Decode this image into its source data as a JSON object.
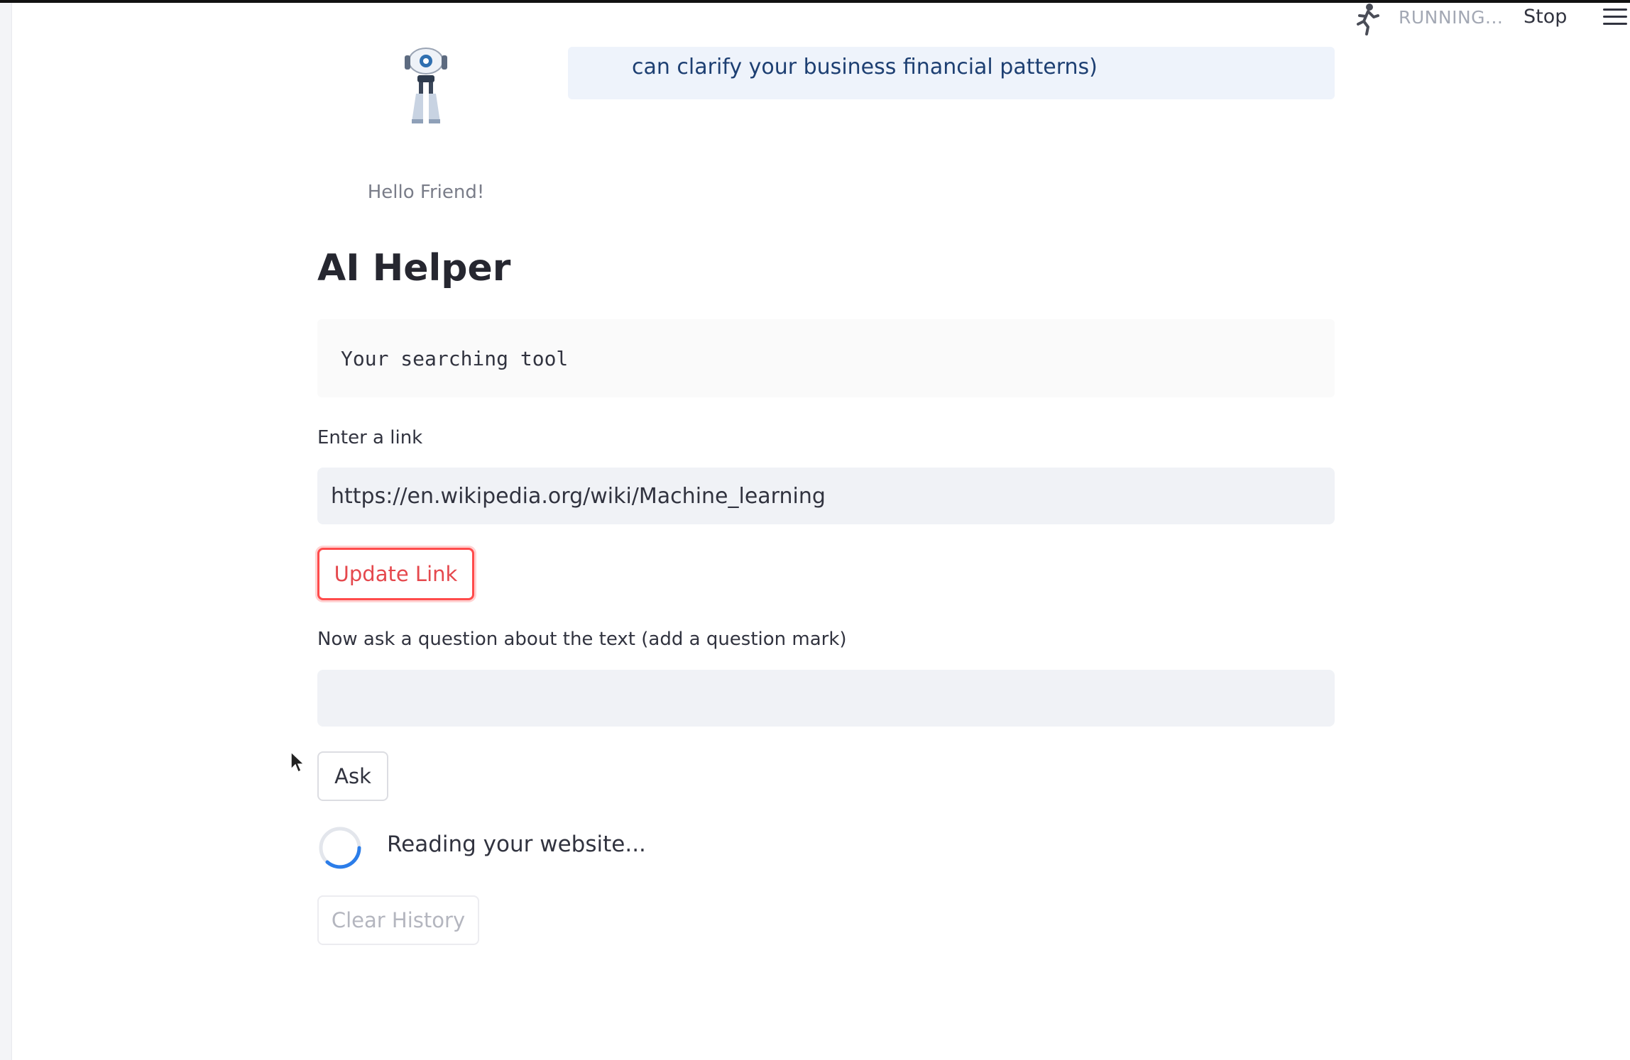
{
  "toolbar": {
    "status_text": "RUNNING...",
    "stop_label": "Stop",
    "status_icon": "running-man-icon",
    "menu_icon": "hamburger-menu-icon"
  },
  "sidebar": {
    "avatar_icon": "robot-icon",
    "greeting": "Hello Friend!"
  },
  "info": {
    "text": "can clarify your business financial patterns)"
  },
  "main": {
    "title": "AI Helper",
    "subtitle_code": "Your searching tool",
    "link_label": "Enter a link",
    "link_value": "https://en.wikipedia.org/wiki/Machine_learning",
    "update_button": "Update Link",
    "question_label": "Now ask a question about the text (add a question mark)",
    "question_value": "",
    "ask_button": "Ask",
    "spinner_text": "Reading your website...",
    "clear_button": "Clear History"
  },
  "colors": {
    "accent": "#ff4b4b",
    "info_bg": "#eef3fb",
    "info_text": "#1d3f72",
    "input_bg": "#f0f2f6",
    "spinner": "#2b7de9"
  }
}
